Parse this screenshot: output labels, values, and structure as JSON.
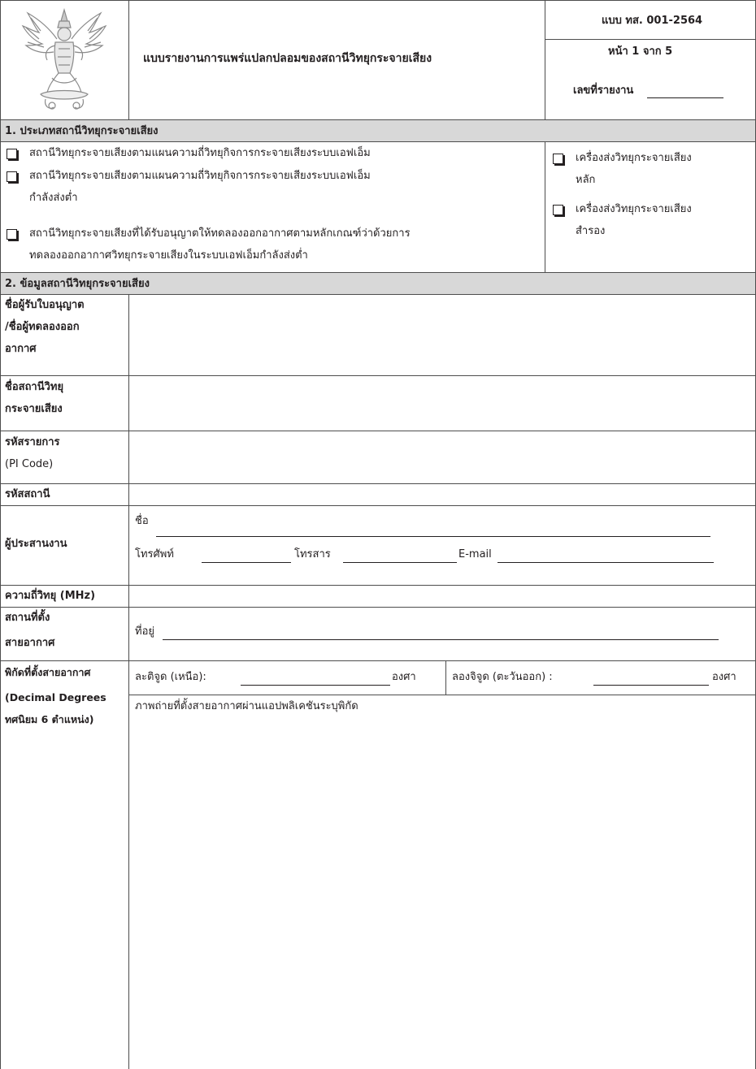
{
  "header": {
    "form_code": "แบบ ทส. 001-2564",
    "page_label": "หน้า 1 จาก 5",
    "report_no_label": "เลขที่รายงาน",
    "title": "แบบรายงานการแพร่แปลกปลอมของสถานีวิทยุกระจายเสียง",
    "emblem_icon": "garuda-emblem-icon"
  },
  "section1": {
    "heading": "1. ประเภทสถานีวิทยุกระจายเสียง",
    "options": [
      {
        "lines": [
          "สถานีวิทยุกระจายเสียงตามแผนความถี่วิทยุกิจการกระจายเสียงระบบเอฟเอ็ม"
        ]
      },
      {
        "lines": [
          "สถานีวิทยุกระจายเสียงตามแผนความถี่วิทยุกิจการกระจายเสียงระบบเอฟเอ็ม",
          "กำลังส่งต่ำ"
        ]
      },
      {
        "lines": [
          "สถานีวิทยุกระจายเสียงที่ได้รับอนุญาตให้ทดลองออกอากาศตามหลักเกณฑ์ว่าด้วยการ",
          "ทดลองออกอากาศวิทยุกระจายเสียงในระบบเอฟเอ็มกำลังส่งต่ำ"
        ]
      }
    ],
    "transmitters": [
      {
        "lines": [
          "เครื่องส่งวิทยุกระจายเสียง",
          "หลัก"
        ]
      },
      {
        "lines": [
          "เครื่องส่งวิทยุกระจายเสียง",
          "สำรอง"
        ]
      }
    ]
  },
  "section2": {
    "heading": "2. ข้อมูลสถานีวิทยุกระจายเสียง",
    "licensee": {
      "lines": [
        "ชื่อผู้รับใบอนุญาต",
        "/ชื่อผู้ทดลองออก",
        "อากาศ"
      ]
    },
    "station_name": {
      "lines": [
        "ชื่อสถานีวิทยุ",
        "กระจายเสียง"
      ]
    },
    "pi_code": {
      "lines": [
        "รหัสรายการ",
        "(PI Code)"
      ]
    },
    "station_code": "รหัสสถานี",
    "coordinator": {
      "label": "ผู้ประสานงาน",
      "name_label": "ชื่อ",
      "phone_label": "โทรศัพท์",
      "fax_label": "โทรสาร",
      "email_label": "E-mail"
    },
    "frequency": "ความถี่วิทยุ (MHz)",
    "antenna_site": {
      "lines": [
        "สถานที่ตั้ง",
        "สายอากาศ"
      ],
      "address_label": "ที่อยู่"
    },
    "antenna_coords": {
      "lines": [
        "พิกัดที่ตั้งสายอากาศ",
        "(Decimal Degrees",
        "ทศนิยม 6 ตำแหน่ง)"
      ],
      "lat_label": "ละติจูด (เหนือ):",
      "lat_unit": "องศา",
      "lon_label": "ลองจิจูด (ตะวันออก) :",
      "lon_unit": "องศา",
      "photo_label": "ภาพถ่ายที่ตั้งสายอากาศผ่านแอปพลิเคชันระบุพิกัด"
    }
  }
}
